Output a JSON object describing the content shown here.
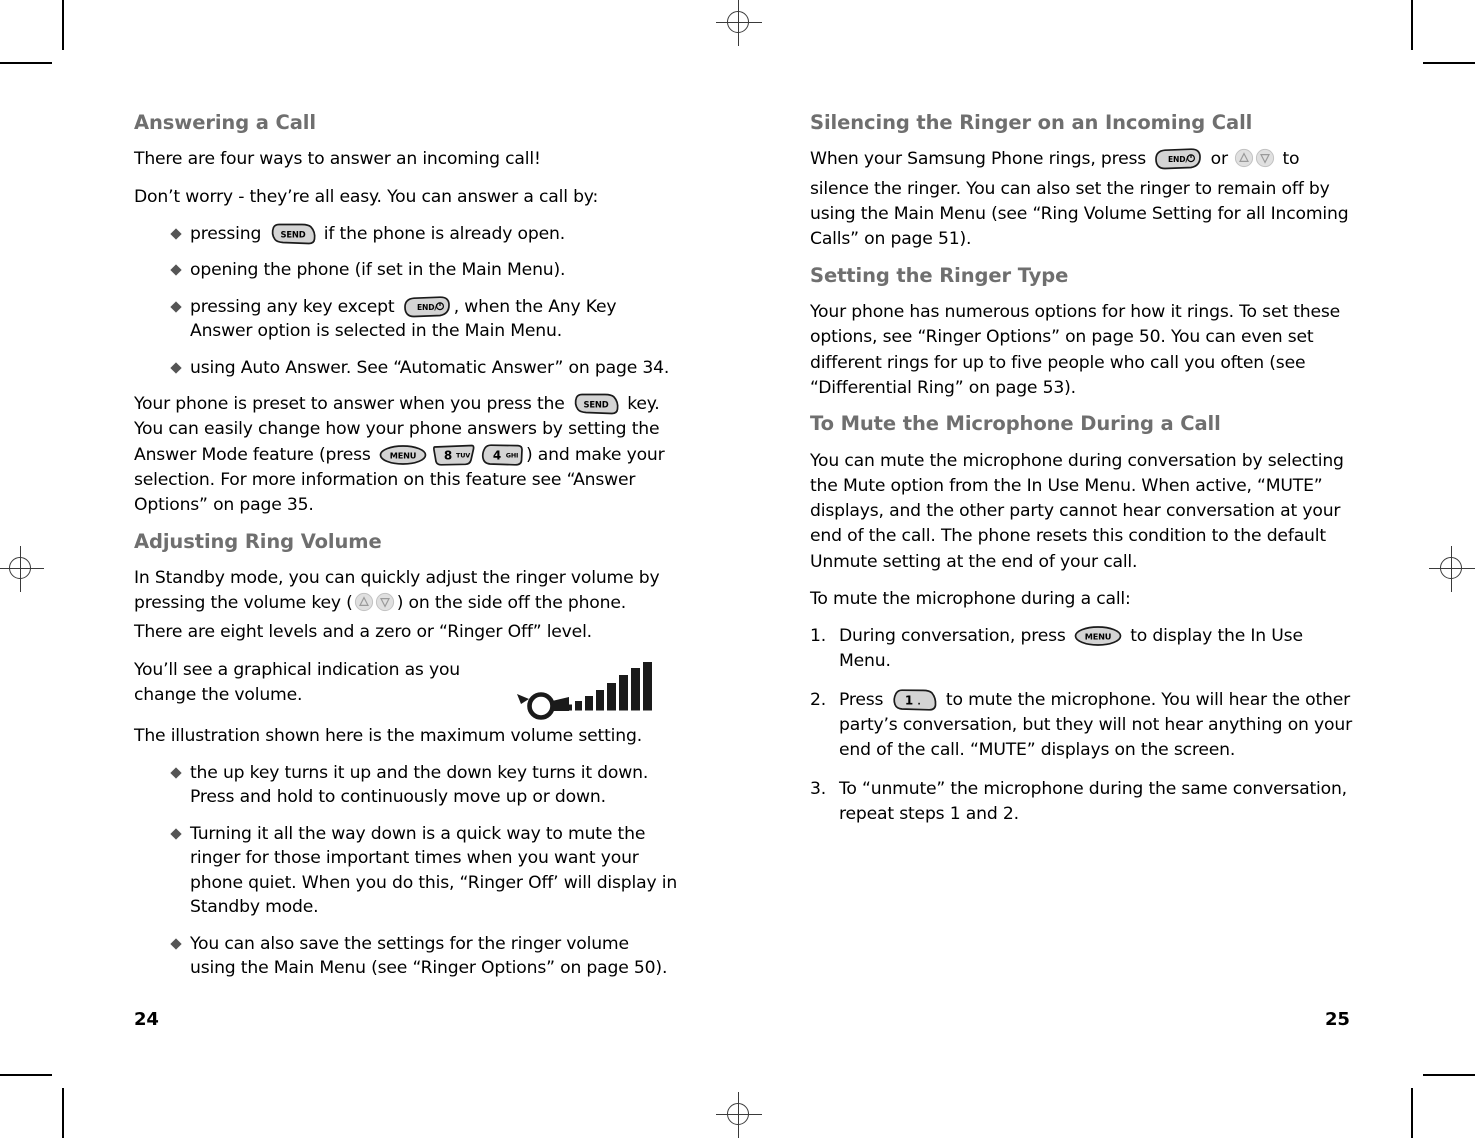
{
  "document": {
    "type": "phone-user-manual-spread",
    "left_page_number": "24",
    "right_page_number": "25"
  },
  "left_column": {
    "heading_1": "Answering a Call",
    "para_1": "There are four ways to answer an incoming call!",
    "para_2": "Don’t worry - they’re all easy. You can answer a call by:",
    "bullets_1": [
      {
        "before": "pressing ",
        "key": "SEND",
        "after": " if the phone is already open."
      },
      {
        "before": "opening the phone (if set in the Main Menu).",
        "key": "",
        "after": ""
      },
      {
        "before": "pressing any key except ",
        "key": "END/⏻",
        "after": ", when the Any Key Answer option is selected in the Main Menu."
      },
      {
        "before": "using Auto Answer. See “Automatic Answer” on page 34.",
        "key": "",
        "after": ""
      }
    ],
    "para_3_a": "Your phone is preset to answer when you press the ",
    "para_3_key1": "SEND",
    "para_3_b": " key. You can easily change how your phone answers by setting the Answer Mode feature (press ",
    "para_3_key2": "MENU",
    "para_3_key3": "8TUV",
    "para_3_key4": "4GHI",
    "para_3_c": ") and make your selection. For more information on this feature see “Answer Options” on page 35.",
    "heading_2": "Adjusting Ring Volume",
    "para_4_a": "In Standby mode, you can quickly adjust the ringer volume by pressing the volume key (",
    "para_4_b": ") on the side off the phone. There are eight levels and a zero or “Ringer Off” level.",
    "para_5": "You’ll see a graphical indication as you change the volume.",
    "para_6": "The illustration shown here is the maximum volume setting.",
    "bullets_2": [
      "the up key turns it up and the down key turns it down. Press and hold to continuously move up or down.",
      "Turning it all the way down is a quick way to mute the ringer for those important times when you want your phone quiet. When you do this, “Ringer Off’ will display in Standby mode.",
      "You can also save the settings for the ringer volume using the Main Menu (see “Ringer Options” on page 50)."
    ]
  },
  "right_column": {
    "heading_1": "Silencing the Ringer on an Incoming Call",
    "para_1_a": "When your Samsung Phone rings, press ",
    "para_1_key": "END/⏻",
    "para_1_b": " or ",
    "para_1_c": " to silence the ringer. You can also set the ringer to remain off by using the Main Menu (see “Ring Volume Setting for all Incoming Calls” on page 51).",
    "heading_2": "Setting the Ringer Type",
    "para_2": "Your phone has numerous options for how it rings. To set these options, see “Ringer Options” on page 50. You can even set different rings for up to five people who call you often (see “Differential Ring” on page 53).",
    "heading_3": "To Mute the Microphone During a Call",
    "para_3": "You can mute the microphone during conversation by selecting the Mute option from the In Use Menu. When active, “MUTE” displays, and the other party cannot hear conversation at your end of the call. The phone resets this condition to the default Unmute setting at the end of your call.",
    "para_4": "To mute the microphone during a call:",
    "steps": [
      {
        "num": "1.",
        "before": "During conversation, press ",
        "key": "MENU",
        "after": " to display the In Use Menu."
      },
      {
        "num": "2.",
        "before": "Press ",
        "key": "1.",
        "after": " to mute the microphone. You will hear the other party’s conversation, but they will not hear anything on your end of the call. “MUTE” displays on the screen."
      },
      {
        "num": "3.",
        "before": "To “unmute” the microphone during the same conversation, repeat steps 1 and 2.",
        "key": "",
        "after": ""
      }
    ]
  },
  "graphics": {
    "volume_indicator": {
      "name": "horn-volume-icon",
      "bars": 8,
      "label": "maximum volume setting"
    },
    "key_labels": {
      "send": "SEND",
      "end": "END/⏻",
      "menu": "MENU",
      "eight": "8TUV",
      "four": "4GHI",
      "one": "1."
    }
  },
  "colors": {
    "heading": "#6f6f6f",
    "body": "#000000",
    "key_fill": "#d4d4d4",
    "key_stroke": "#1a1a1a",
    "bullet": "#555555"
  }
}
